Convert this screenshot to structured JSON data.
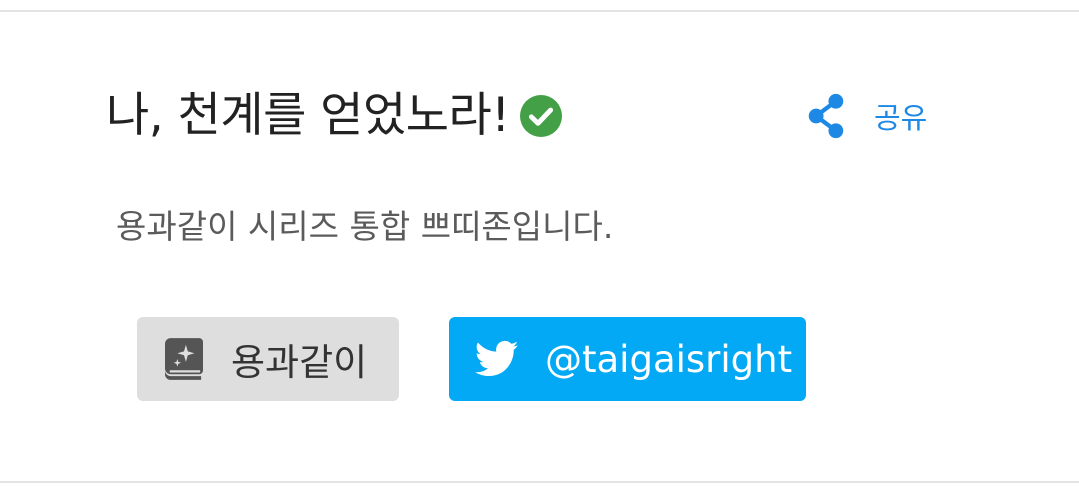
{
  "header": {
    "title": "나, 천계를 얻었노라!",
    "verified_icon": "check-circle-icon",
    "verified_color": "#43a047",
    "share_label": "공유",
    "share_icon": "share-icon",
    "share_color": "#1e88e5"
  },
  "description": "용과같이 시리즈 통합 쁘띠존입니다.",
  "buttons": {
    "series": {
      "label": "용과같이",
      "icon": "book-sparkle-icon",
      "background": "#dedede"
    },
    "twitter": {
      "label": "@taigaisright",
      "icon": "twitter-icon",
      "background": "#03a9f4"
    }
  }
}
